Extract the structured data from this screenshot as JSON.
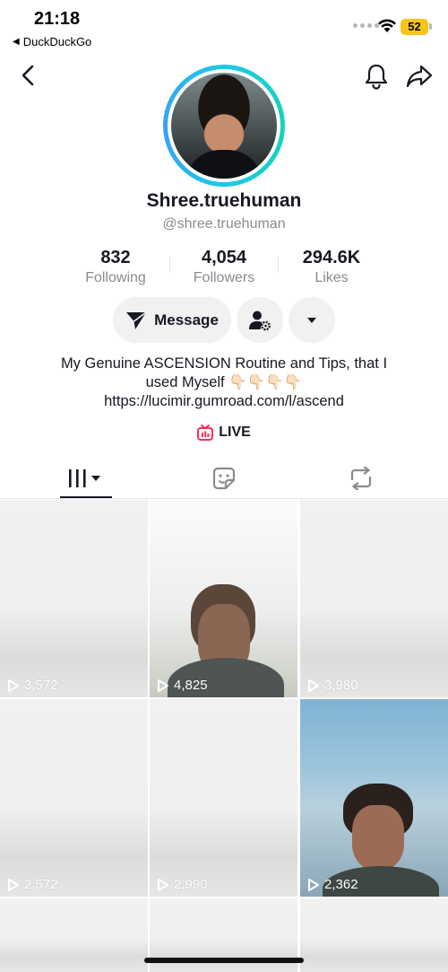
{
  "status": {
    "time": "21:18",
    "back_app": "DuckDuckGo",
    "battery": "52"
  },
  "nav": {
    "back_icon": "chevron-left-icon",
    "bell_icon": "bell-icon",
    "share_icon": "share-arrow-icon"
  },
  "profile": {
    "display_name": "Shree.truehuman",
    "handle": "@shree.truehuman",
    "accent_ring": "#1ec8e8"
  },
  "stats": [
    {
      "value": "832",
      "label": "Following"
    },
    {
      "value": "4,054",
      "label": "Followers"
    },
    {
      "value": "294.6K",
      "label": "Likes"
    }
  ],
  "actions": {
    "message_label": "Message",
    "add_friend_icon": "person-gear-icon",
    "more_icon": "caret-down-icon"
  },
  "bio": {
    "line1": "My Genuine ASCENSION Routine and Tips, that I",
    "line2": "used Myself 👇🏻👇🏻👇🏻👇🏻",
    "link": "https://lucimir.gumroad.com/l/ascend"
  },
  "live": {
    "label": "LIVE",
    "color": "#fe2c55"
  },
  "tabs": [
    {
      "name": "videos",
      "icon": "grid-bars-icon",
      "active": true
    },
    {
      "name": "favorites",
      "icon": "sticker-icon",
      "active": false
    },
    {
      "name": "reposts",
      "icon": "repost-icon",
      "active": false
    }
  ],
  "videos": [
    {
      "views": "3,572"
    },
    {
      "views": "4,825"
    },
    {
      "views": "3,980"
    },
    {
      "views": "2,572"
    },
    {
      "views": "2,990"
    },
    {
      "views": "2,362"
    }
  ]
}
